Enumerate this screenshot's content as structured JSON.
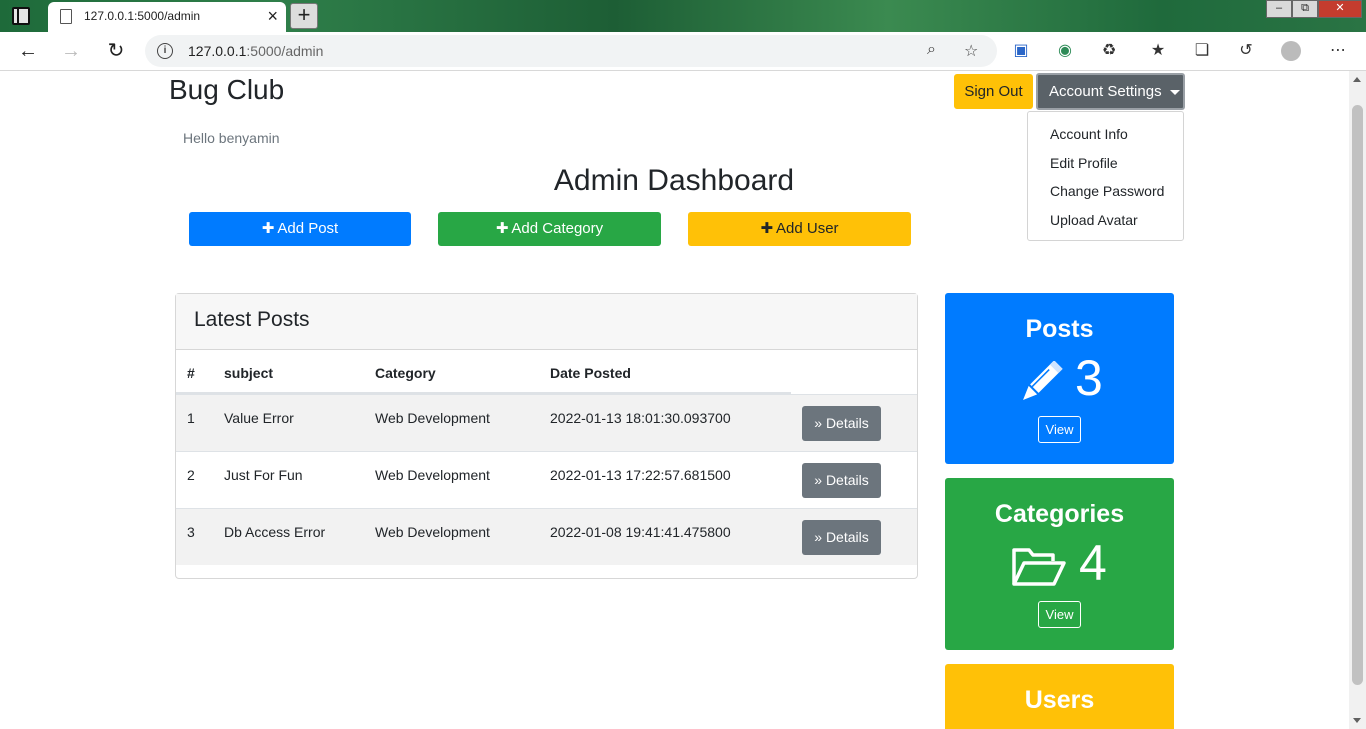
{
  "browser": {
    "tab_title": "127.0.0.1:5000/admin",
    "url_host": "127.0.0.1",
    "url_rest": ":5000/admin",
    "new_tab_symbol": "+",
    "close_tab_symbol": "×"
  },
  "navbar": {
    "brand": "Bug Club",
    "sign_out": "Sign Out",
    "account_settings": "Account Settings",
    "dropdown_items": [
      "Account Info",
      "Edit Profile",
      "Change Password",
      "Upload Avatar"
    ]
  },
  "greeting": "Hello benyamin",
  "page_title": "Admin Dashboard",
  "actions": {
    "add_post": "Add Post",
    "add_category": "Add Category",
    "add_user": "Add User"
  },
  "latest_posts": {
    "title": "Latest Posts",
    "columns": [
      "#",
      "subject",
      "Category",
      "Date Posted"
    ],
    "rows": [
      {
        "num": "1",
        "subject": "Value Error",
        "category": "Web Development",
        "date": "2022-01-13 18:01:30.093700",
        "button": "Details"
      },
      {
        "num": "2",
        "subject": "Just For Fun",
        "category": "Web Development",
        "date": "2022-01-13 17:22:57.681500",
        "button": "Details"
      },
      {
        "num": "3",
        "subject": "Db Access Error",
        "category": "Web Development",
        "date": "2022-01-08 19:41:41.475800",
        "button": "Details"
      }
    ]
  },
  "stats": {
    "posts": {
      "title": "Posts",
      "count": "3",
      "view": "View",
      "icon": "pencil-icon"
    },
    "categories": {
      "title": "Categories",
      "count": "4",
      "view": "View",
      "icon": "folder-open-icon"
    },
    "users": {
      "title": "Users",
      "icon": "users-icon"
    }
  },
  "colors": {
    "primary": "#007bff",
    "success": "#28a745",
    "warning": "#ffc107",
    "secondary": "#6c757d"
  }
}
